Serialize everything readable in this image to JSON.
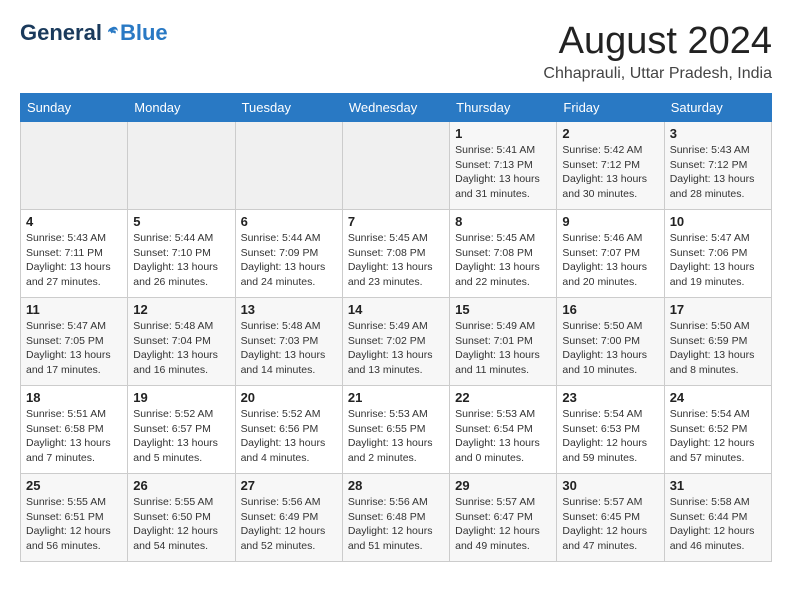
{
  "header": {
    "logo_general": "General",
    "logo_blue": "Blue",
    "month_year": "August 2024",
    "location": "Chhaprauli, Uttar Pradesh, India"
  },
  "days_of_week": [
    "Sunday",
    "Monday",
    "Tuesday",
    "Wednesday",
    "Thursday",
    "Friday",
    "Saturday"
  ],
  "weeks": [
    [
      {
        "day": "",
        "info": ""
      },
      {
        "day": "",
        "info": ""
      },
      {
        "day": "",
        "info": ""
      },
      {
        "day": "",
        "info": ""
      },
      {
        "day": "1",
        "info": "Sunrise: 5:41 AM\nSunset: 7:13 PM\nDaylight: 13 hours\nand 31 minutes."
      },
      {
        "day": "2",
        "info": "Sunrise: 5:42 AM\nSunset: 7:12 PM\nDaylight: 13 hours\nand 30 minutes."
      },
      {
        "day": "3",
        "info": "Sunrise: 5:43 AM\nSunset: 7:12 PM\nDaylight: 13 hours\nand 28 minutes."
      }
    ],
    [
      {
        "day": "4",
        "info": "Sunrise: 5:43 AM\nSunset: 7:11 PM\nDaylight: 13 hours\nand 27 minutes."
      },
      {
        "day": "5",
        "info": "Sunrise: 5:44 AM\nSunset: 7:10 PM\nDaylight: 13 hours\nand 26 minutes."
      },
      {
        "day": "6",
        "info": "Sunrise: 5:44 AM\nSunset: 7:09 PM\nDaylight: 13 hours\nand 24 minutes."
      },
      {
        "day": "7",
        "info": "Sunrise: 5:45 AM\nSunset: 7:08 PM\nDaylight: 13 hours\nand 23 minutes."
      },
      {
        "day": "8",
        "info": "Sunrise: 5:45 AM\nSunset: 7:08 PM\nDaylight: 13 hours\nand 22 minutes."
      },
      {
        "day": "9",
        "info": "Sunrise: 5:46 AM\nSunset: 7:07 PM\nDaylight: 13 hours\nand 20 minutes."
      },
      {
        "day": "10",
        "info": "Sunrise: 5:47 AM\nSunset: 7:06 PM\nDaylight: 13 hours\nand 19 minutes."
      }
    ],
    [
      {
        "day": "11",
        "info": "Sunrise: 5:47 AM\nSunset: 7:05 PM\nDaylight: 13 hours\nand 17 minutes."
      },
      {
        "day": "12",
        "info": "Sunrise: 5:48 AM\nSunset: 7:04 PM\nDaylight: 13 hours\nand 16 minutes."
      },
      {
        "day": "13",
        "info": "Sunrise: 5:48 AM\nSunset: 7:03 PM\nDaylight: 13 hours\nand 14 minutes."
      },
      {
        "day": "14",
        "info": "Sunrise: 5:49 AM\nSunset: 7:02 PM\nDaylight: 13 hours\nand 13 minutes."
      },
      {
        "day": "15",
        "info": "Sunrise: 5:49 AM\nSunset: 7:01 PM\nDaylight: 13 hours\nand 11 minutes."
      },
      {
        "day": "16",
        "info": "Sunrise: 5:50 AM\nSunset: 7:00 PM\nDaylight: 13 hours\nand 10 minutes."
      },
      {
        "day": "17",
        "info": "Sunrise: 5:50 AM\nSunset: 6:59 PM\nDaylight: 13 hours\nand 8 minutes."
      }
    ],
    [
      {
        "day": "18",
        "info": "Sunrise: 5:51 AM\nSunset: 6:58 PM\nDaylight: 13 hours\nand 7 minutes."
      },
      {
        "day": "19",
        "info": "Sunrise: 5:52 AM\nSunset: 6:57 PM\nDaylight: 13 hours\nand 5 minutes."
      },
      {
        "day": "20",
        "info": "Sunrise: 5:52 AM\nSunset: 6:56 PM\nDaylight: 13 hours\nand 4 minutes."
      },
      {
        "day": "21",
        "info": "Sunrise: 5:53 AM\nSunset: 6:55 PM\nDaylight: 13 hours\nand 2 minutes."
      },
      {
        "day": "22",
        "info": "Sunrise: 5:53 AM\nSunset: 6:54 PM\nDaylight: 13 hours\nand 0 minutes."
      },
      {
        "day": "23",
        "info": "Sunrise: 5:54 AM\nSunset: 6:53 PM\nDaylight: 12 hours\nand 59 minutes."
      },
      {
        "day": "24",
        "info": "Sunrise: 5:54 AM\nSunset: 6:52 PM\nDaylight: 12 hours\nand 57 minutes."
      }
    ],
    [
      {
        "day": "25",
        "info": "Sunrise: 5:55 AM\nSunset: 6:51 PM\nDaylight: 12 hours\nand 56 minutes."
      },
      {
        "day": "26",
        "info": "Sunrise: 5:55 AM\nSunset: 6:50 PM\nDaylight: 12 hours\nand 54 minutes."
      },
      {
        "day": "27",
        "info": "Sunrise: 5:56 AM\nSunset: 6:49 PM\nDaylight: 12 hours\nand 52 minutes."
      },
      {
        "day": "28",
        "info": "Sunrise: 5:56 AM\nSunset: 6:48 PM\nDaylight: 12 hours\nand 51 minutes."
      },
      {
        "day": "29",
        "info": "Sunrise: 5:57 AM\nSunset: 6:47 PM\nDaylight: 12 hours\nand 49 minutes."
      },
      {
        "day": "30",
        "info": "Sunrise: 5:57 AM\nSunset: 6:45 PM\nDaylight: 12 hours\nand 47 minutes."
      },
      {
        "day": "31",
        "info": "Sunrise: 5:58 AM\nSunset: 6:44 PM\nDaylight: 12 hours\nand 46 minutes."
      }
    ]
  ]
}
